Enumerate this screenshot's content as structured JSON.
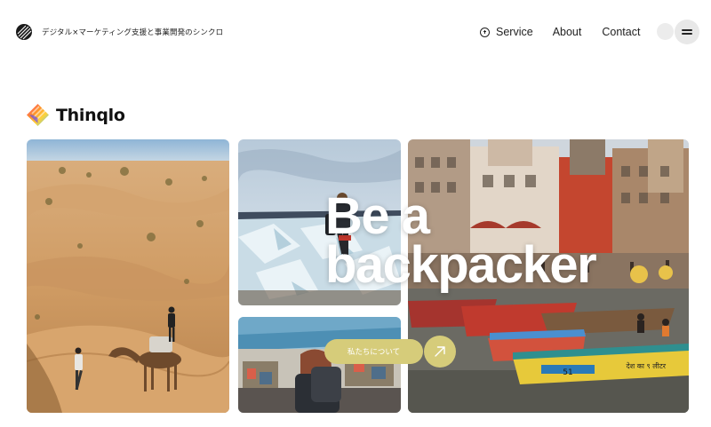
{
  "header": {
    "tagline": "デジタル×マーケティング支援と事業開発のシンクロ",
    "nav": [
      {
        "label": "Service"
      },
      {
        "label": "About"
      },
      {
        "label": "Contact"
      }
    ]
  },
  "brand": {
    "name": "Thinqlo"
  },
  "hero": {
    "headline_line1": "Be a",
    "headline_line2": "backpacker"
  },
  "cta": {
    "label": "私たちについて"
  },
  "icons": {
    "site_logo": "scribble-ball-icon",
    "service_plus": "plus-circle-icon",
    "menu": "hamburger-icon",
    "cta_arrow": "arrow-up-right-icon",
    "brand_logo": "gradient-diamond-icon"
  },
  "colors": {
    "cta_accent": "#d6cc7a",
    "text": "#222222",
    "background": "#ffffff"
  },
  "river_boats": {
    "sign_text": "देश का ९ लीटर",
    "boat_number": "51"
  }
}
